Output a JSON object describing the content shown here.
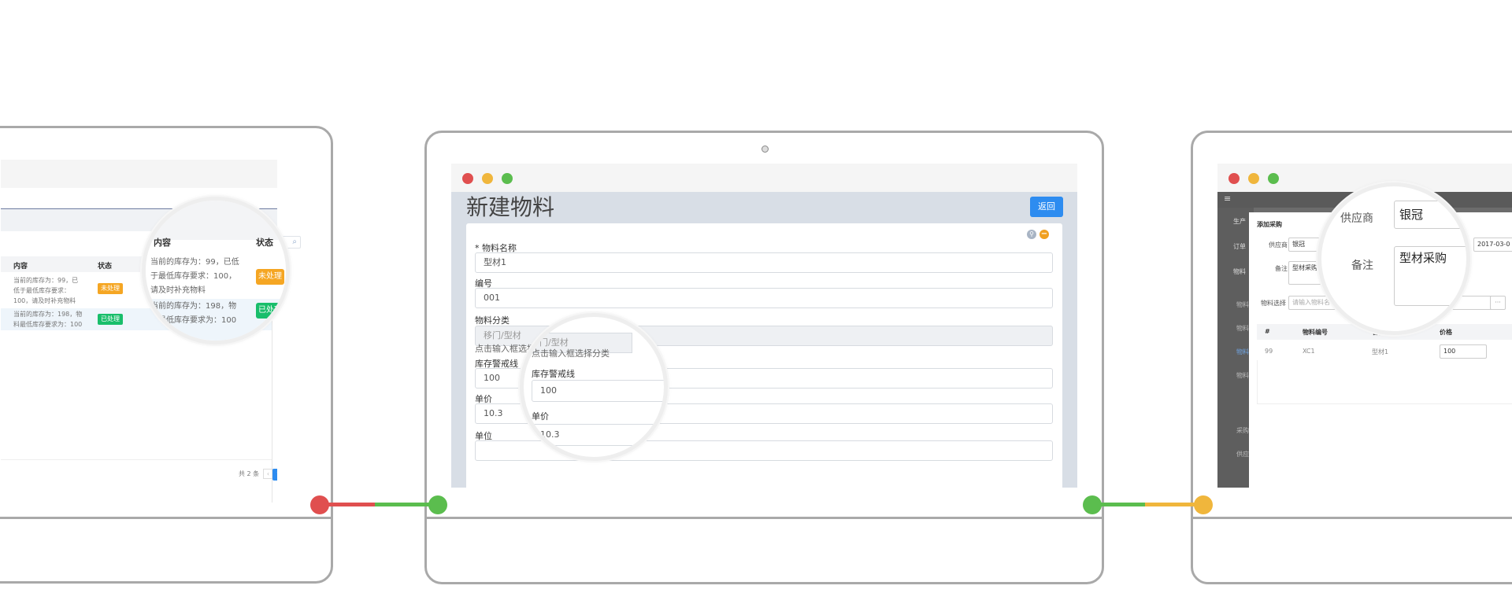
{
  "left_app": {
    "table": {
      "headers": [
        "内容",
        "状态"
      ],
      "rows": [
        {
          "content": "当前的库存为：99，已低于最低库存要求：100，请及时补充物料",
          "status": "未处理"
        },
        {
          "content": "当前的库存为：198，物料最低库存要求为：100",
          "status": "已处理"
        }
      ]
    },
    "pagination": {
      "total": "共 2 条",
      "prev": "‹",
      "page": "1",
      "next": "›"
    },
    "search_icon": "search-icon",
    "magnifier": {
      "headers": [
        "内容",
        "状态"
      ],
      "row1_content": "当前的库存为：99，已低于最低库存要求：100，请及时补充物料",
      "row1_status": "未处理",
      "row2_content": "当前的库存为：198，物料最低库存要求为：100",
      "row2_status": "已处理"
    }
  },
  "center_app": {
    "page_title": "新建物料",
    "back_button": "返回",
    "icons": [
      "link-icon",
      "minus-icon"
    ],
    "form": {
      "name_label": "* 物料名称",
      "name_value": "型材1",
      "code_label": "编号",
      "code_value": "001",
      "category_label": "物料分类",
      "category_value": "移门/型材",
      "category_hint": "点击输入框选择分类",
      "stock_label": "库存警戒线",
      "stock_value": "100",
      "price_label": "单价",
      "price_value": "10.3",
      "unit_label": "单位"
    },
    "magnifier": {
      "category_value": "移门/型材",
      "category_hint": "点击输入框选择分类",
      "stock_label": "库存警戒线",
      "stock_value": "100",
      "price_label": "单价",
      "price_value": "10.3"
    }
  },
  "right_app": {
    "sidebar": [
      "生产",
      "订单",
      "物料",
      "物料",
      "物料",
      "物料",
      "物料",
      "物料",
      "采购",
      "采购",
      "供应"
    ],
    "dialog_title": "添加采购",
    "supplier_label": "供应商",
    "supplier_value": "银冠",
    "date_suffix": "期",
    "date_value": "2017-03-0",
    "remark_label": "备注",
    "remark_value": "型材采购",
    "material_select_label": "物料选择",
    "material_placeholder": "请输入物料名称",
    "material_btn": "···",
    "table_headers": [
      "#",
      "物料编号",
      "名称",
      "价格"
    ],
    "table_row": {
      "index": "99",
      "code": "XC1",
      "name": "型材1",
      "price": "100"
    },
    "magnifier": {
      "supplier_label": "供应商",
      "supplier_value": "银冠",
      "remark_label": "备注",
      "remark_value": "型材采购"
    }
  },
  "colors": {
    "frame": "#a9a9a9",
    "red": "#e04f4f",
    "yellow": "#f0b63c",
    "green": "#5bbd4e",
    "primary": "#2d8cf0"
  }
}
